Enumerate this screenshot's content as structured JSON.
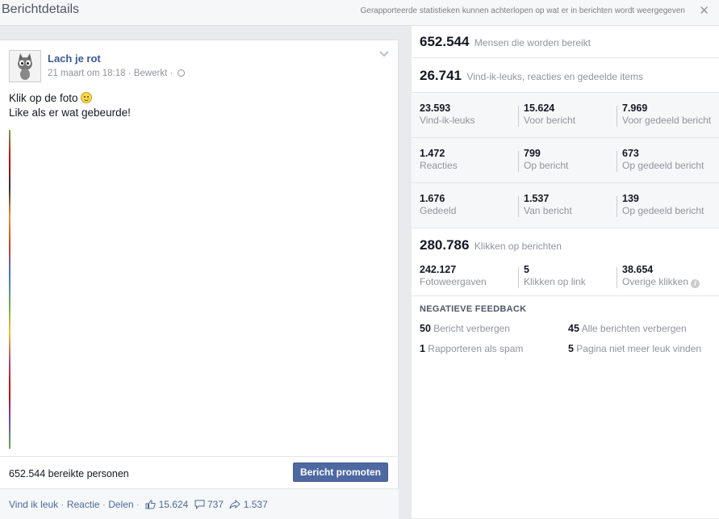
{
  "header": {
    "title": "Berichtdetails",
    "notice": "Gerapporteerde statistieken kunnen achterlopen op wat er in berichten wordt weergegeven",
    "close": "✕"
  },
  "post": {
    "page_name": "Lach je rot",
    "timestamp": "21 maart om 18:18",
    "edited": "Bewerkt",
    "separator": "·",
    "text_line1": "Klik op de foto",
    "text_line2": "Like als er wat gebeurde!",
    "reach_text": "652.544 bereikte personen",
    "promote_label": "Bericht promoten",
    "actions": {
      "like": "Vind ik leuk",
      "comment": "Reactie",
      "share": "Delen",
      "sep": "·",
      "like_count": "15.624",
      "comment_count": "737",
      "share_count": "1.537"
    }
  },
  "stats": {
    "reach": {
      "value": "652.544",
      "label": "Mensen die worden bereikt"
    },
    "engagement": {
      "value": "26.741",
      "label": "Vind-ik-leuks, reacties en gedeelde items"
    },
    "rows": [
      [
        {
          "value": "23.593",
          "label": "Vind-ik-leuks"
        },
        {
          "value": "15.624",
          "label": "Voor bericht"
        },
        {
          "value": "7.969",
          "label": "Voor gedeeld bericht"
        }
      ],
      [
        {
          "value": "1.472",
          "label": "Reacties"
        },
        {
          "value": "799",
          "label": "Op bericht"
        },
        {
          "value": "673",
          "label": "Op gedeeld bericht"
        }
      ],
      [
        {
          "value": "1.676",
          "label": "Gedeeld"
        },
        {
          "value": "1.537",
          "label": "Van bericht"
        },
        {
          "value": "139",
          "label": "Op gedeeld bericht"
        }
      ]
    ],
    "clicks": {
      "value": "280.786",
      "label": "Klikken op berichten"
    },
    "click_breakdown": [
      {
        "value": "242.127",
        "label": "Fotoweergaven"
      },
      {
        "value": "5",
        "label": "Klikken op link"
      },
      {
        "value": "38.654",
        "label": "Overige klikken"
      }
    ],
    "negative": {
      "title": "NEGATIEVE FEEDBACK",
      "items": [
        {
          "value": "50",
          "label": "Bericht verbergen"
        },
        {
          "value": "45",
          "label": "Alle berichten verbergen"
        },
        {
          "value": "1",
          "label": "Rapporteren als spam"
        },
        {
          "value": "5",
          "label": "Pagina niet meer leuk vinden"
        }
      ]
    }
  }
}
